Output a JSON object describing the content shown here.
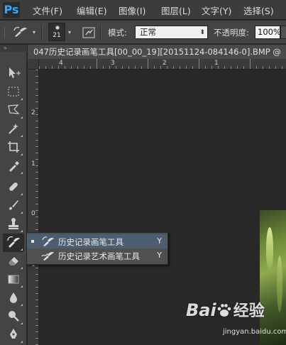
{
  "app": {
    "logo": "Ps"
  },
  "menubar": {
    "items": [
      {
        "label": "文件(F)"
      },
      {
        "label": "编辑(E)"
      },
      {
        "label": "图像(I)"
      },
      {
        "label": "图层(L)"
      },
      {
        "label": "文字(Y)"
      },
      {
        "label": "选择(S)"
      }
    ]
  },
  "options": {
    "brush_size": "21",
    "mode_label": "模式:",
    "mode_value": "正常",
    "opacity_label": "不透明度:",
    "opacity_value": "100%"
  },
  "document": {
    "tab_title": "047历史记录画笔工具[00_00_19][20151124-084146-0].BMP @"
  },
  "rulers": {
    "top": [
      "4",
      "3",
      "2",
      "1"
    ],
    "left": [
      "2",
      "1",
      "0",
      "1"
    ]
  },
  "flyout": {
    "items": [
      {
        "label": "历史记录画笔工具",
        "shortcut": "Y",
        "selected": true
      },
      {
        "label": "历史记录艺术画笔工具",
        "shortcut": "Y",
        "selected": false
      }
    ]
  },
  "watermark": {
    "logo_text": "Bai",
    "logo_cn": "经验",
    "url": "jingyan.baidu.com"
  },
  "colors": {
    "selection": "#4d5e70",
    "canvas_bg": "#282828",
    "panel_bg": "#444444"
  }
}
